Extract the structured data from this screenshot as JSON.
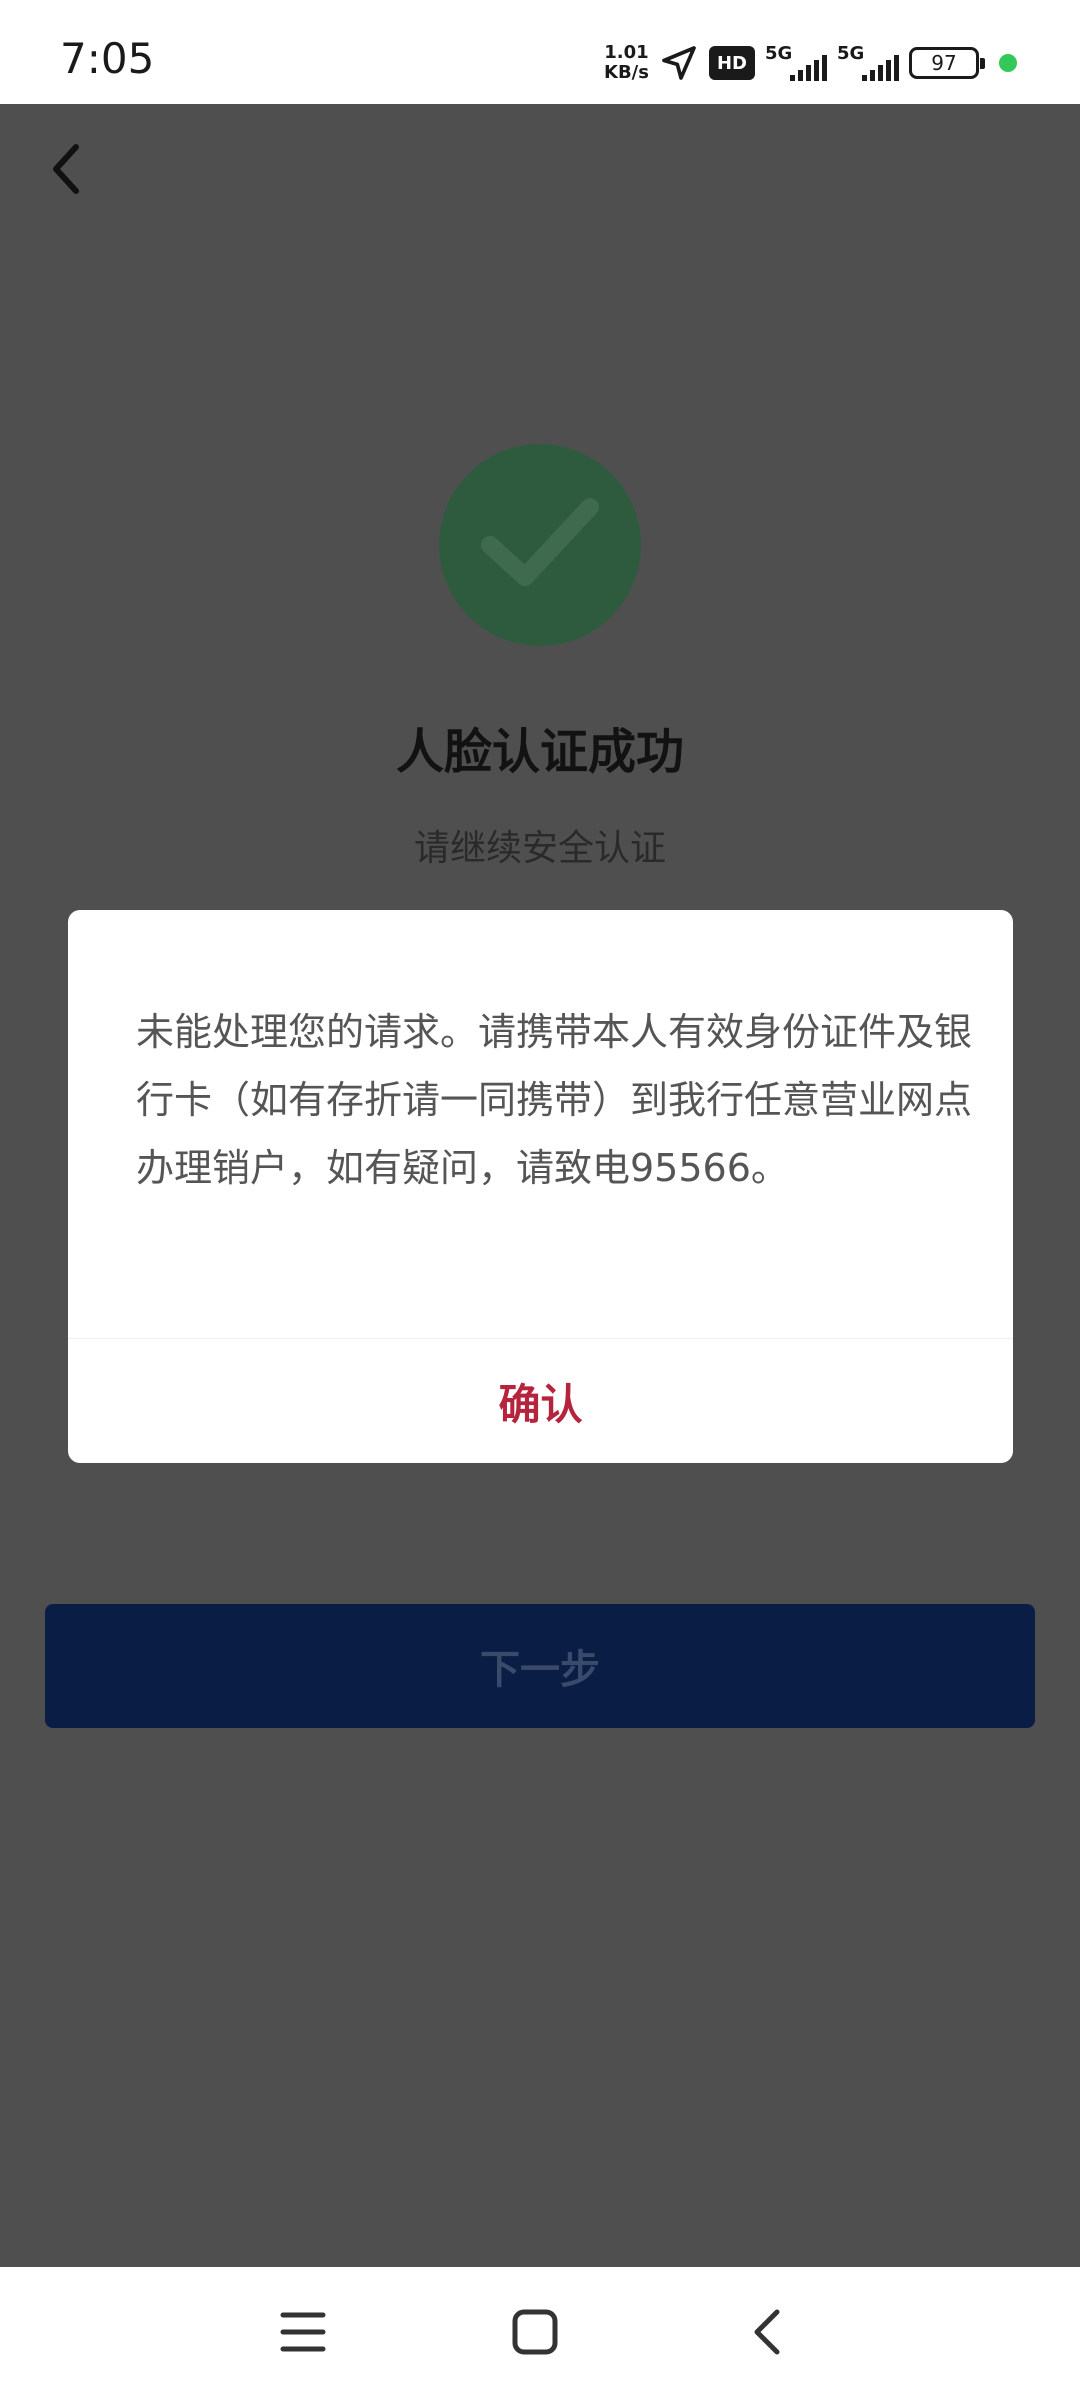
{
  "status_bar": {
    "time": "7:05",
    "net_speed_value": "1.01",
    "net_speed_unit": "KB/s",
    "hd_label": "HD",
    "signal1_label": "5G",
    "signal2_label": "5G",
    "battery": "97",
    "icons": [
      "location-arrow-icon",
      "signal-icon",
      "signal-icon",
      "battery-icon",
      "privacy-indicator-dot"
    ]
  },
  "header": {
    "back_icon": "chevron-left-icon"
  },
  "result": {
    "icon": "check-circle-icon",
    "title": "人脸认证成功",
    "subtitle": "请继续安全认证"
  },
  "next_button": {
    "label": "下一步"
  },
  "dialog": {
    "message": "未能处理您的请求。请携带本人有效身份证件及银行卡（如有存折请一同携带）到我行任意营业网点办理销户，如有疑问，请致电95566。",
    "confirm_label": "确认"
  },
  "nav_bar": {
    "icons": [
      "menu-icon",
      "home-icon",
      "back-icon"
    ]
  },
  "colors": {
    "overlay_bg": "#4f4f4f",
    "success_green": "#2e5b3e",
    "primary_button": "#0a1d45",
    "confirm_red": "#b5243c",
    "indicator_green": "#34c759"
  }
}
